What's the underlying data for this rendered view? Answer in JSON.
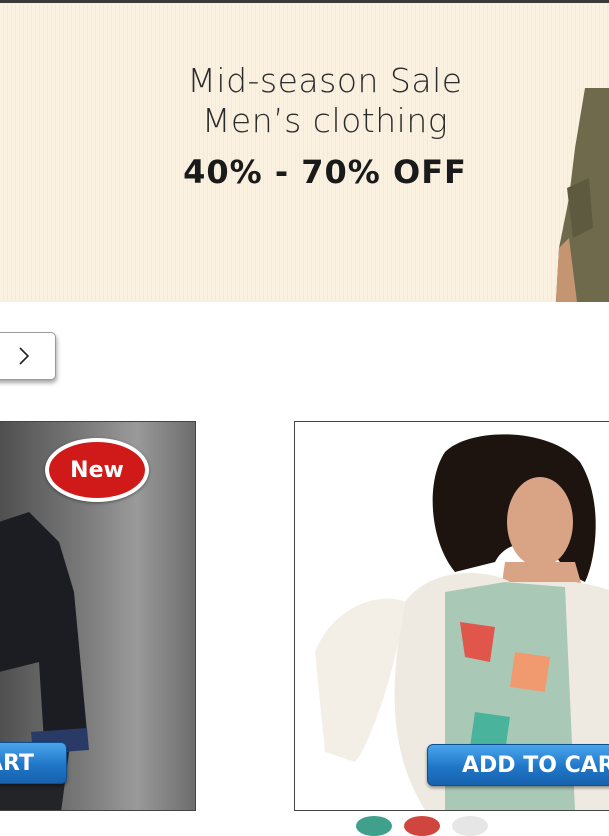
{
  "banner": {
    "line1": "Mid-season Sale",
    "line2": "Men’s clothing",
    "discount": "40% - 70% OFF"
  },
  "carousel": {
    "next_icon": "chevron-right-icon"
  },
  "products": [
    {
      "badge": "New",
      "cart_label": "ADD TO CART"
    },
    {
      "cart_label": "ADD TO CART"
    }
  ],
  "colors": {
    "banner_bg": "#fbf1e1",
    "badge_red": "#d01a1a",
    "button_blue": "#1f76c7"
  }
}
